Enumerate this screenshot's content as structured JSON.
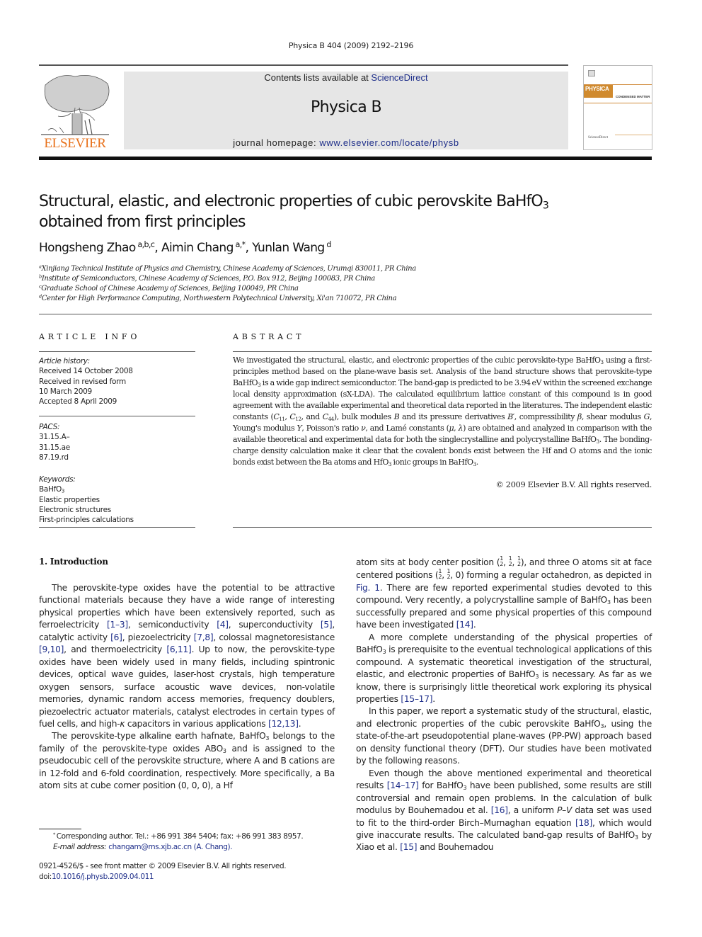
{
  "header": {
    "citation": "Physica B 404 (2009) 2192–2196",
    "contents_prefix": "Contents lists available at ",
    "contents_link": "ScienceDirect",
    "journal_name": "Physica B",
    "homepage_prefix": "journal homepage: ",
    "homepage_link": "www.elsevier.com/locate/physb",
    "publisher_logo_text": "ELSEVIER",
    "cover_title": "PHYSICA",
    "cover_subtitle": "CONDENSED MATTER",
    "cover_publisher": "ScienceDirect",
    "colors": {
      "elsevier_orange": "#e8711b",
      "link_blue": "#1f2f8a",
      "masthead_gray": "#e6e6e6",
      "cover_orange": "#d08a2e"
    }
  },
  "article": {
    "title_line1_pre": "Structural, elastic, and electronic properties of cubic perovskite BaHfO",
    "title_line1_sub": "3",
    "title_line2": "obtained from first principles",
    "authors": [
      {
        "name": "Hongsheng Zhao",
        "affil": "a,b,c"
      },
      {
        "name": "Aimin Chang",
        "affil": "a,*"
      },
      {
        "name": "Yunlan Wang",
        "affil": "d"
      }
    ],
    "affiliations": [
      {
        "key": "a",
        "text": "Xinjiang Technical Institute of Physics and Chemistry, Chinese Academy of Sciences, Urumqi 830011, PR China"
      },
      {
        "key": "b",
        "text": "Institute of Semiconductors, Chinese Academy of Sciences, P.O. Box 912, Beijing 100083, PR China"
      },
      {
        "key": "c",
        "text": "Graduate School of Chinese Academy of Sciences, Beijing 100049, PR China"
      },
      {
        "key": "d",
        "text": "Center for High Performance Computing, Northwestern Polytechnical University, Xi'an 710072, PR China"
      }
    ]
  },
  "article_info": {
    "heading": "ARTICLE INFO",
    "history_label": "Article history:",
    "history": [
      "Received 14 October 2008",
      "Received in revised form",
      "10 March 2009",
      "Accepted 8 April 2009"
    ],
    "pacs_label": "PACS:",
    "pacs": [
      "31.15.A–",
      "31.15.ae",
      "87.19.rd"
    ],
    "keywords_label": "Keywords:",
    "keyword_formula": "BaHfO",
    "keyword_formula_sub": "3",
    "keywords": [
      "Elastic properties",
      "Electronic structures",
      "First-principles calculations"
    ]
  },
  "abstract": {
    "heading": "ABSTRACT",
    "copyright": "© 2009 Elsevier B.V. All rights reserved."
  },
  "intro": {
    "heading": "1.  Introduction",
    "refs": {
      "r1": "[1–3]",
      "r4": "[4]",
      "r5": "[5]",
      "r6": "[6]",
      "r78": "[7,8]",
      "r910": "[9,10]",
      "r611": "[6,11]",
      "r1213": "[12,13]",
      "fig1": "Fig. 1",
      "r14": "[14]",
      "r1517": "[15–17]",
      "r1417": "[14–17]",
      "r16": "[16]",
      "r18": "[18]",
      "r15": "[15]"
    }
  },
  "footnote": {
    "corresponding": "Corresponding author. Tel.: +86 991 384 5404; fax: +86 991 383 8957.",
    "email_label": "E-mail address: ",
    "email": "changam@ms.xjb.ac.cn (A. Chang).",
    "front_matter": "0921-4526/$ - see front matter © 2009 Elsevier B.V. All rights reserved.",
    "doi_label": "doi:",
    "doi": "10.1016/j.physb.2009.04.011"
  }
}
